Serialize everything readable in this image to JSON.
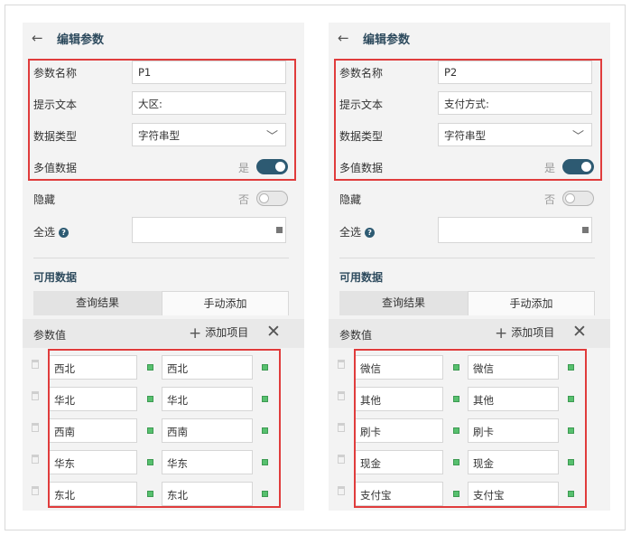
{
  "panels": [
    {
      "back_arrow": "←",
      "title": "编辑参数",
      "param_name_label": "参数名称",
      "param_name_value": "P1",
      "prompt_label": "提示文本",
      "prompt_value": "大区:",
      "data_type_label": "数据类型",
      "data_type_value": "字符串型",
      "multi_value_label": "多值数据",
      "multi_value_state": "是",
      "hidden_label": "隐藏",
      "hidden_state": "否",
      "select_all_label": "全选",
      "available_data_title": "可用数据",
      "tab_query": "查询结果",
      "tab_manual": "手动添加",
      "param_value_label": "参数值",
      "add_item_label": "添加项目",
      "rows": [
        {
          "value": "西北",
          "display": "西北"
        },
        {
          "value": "华北",
          "display": "华北"
        },
        {
          "value": "西南",
          "display": "西南"
        },
        {
          "value": "华东",
          "display": "华东"
        },
        {
          "value": "东北",
          "display": "东北"
        }
      ]
    },
    {
      "back_arrow": "←",
      "title": "编辑参数",
      "param_name_label": "参数名称",
      "param_name_value": "P2",
      "prompt_label": "提示文本",
      "prompt_value": "支付方式:",
      "data_type_label": "数据类型",
      "data_type_value": "字符串型",
      "multi_value_label": "多值数据",
      "multi_value_state": "是",
      "hidden_label": "隐藏",
      "hidden_state": "否",
      "select_all_label": "全选",
      "available_data_title": "可用数据",
      "tab_query": "查询结果",
      "tab_manual": "手动添加",
      "param_value_label": "参数值",
      "add_item_label": "添加项目",
      "rows": [
        {
          "value": "微信",
          "display": "微信"
        },
        {
          "value": "其他",
          "display": "其他"
        },
        {
          "value": "刷卡",
          "display": "刷卡"
        },
        {
          "value": "现金",
          "display": "现金"
        },
        {
          "value": "支付宝",
          "display": "支付宝"
        }
      ]
    }
  ],
  "colors": {
    "accent": "#2d5a72",
    "highlight_box": "#e03c3c",
    "status_green": "#57c06e",
    "panel_bg": "#f3f3f3"
  },
  "icons": [
    "back-arrow-icon",
    "chevron-down-icon",
    "help-icon",
    "plus-icon",
    "close-icon",
    "trash-icon"
  ]
}
